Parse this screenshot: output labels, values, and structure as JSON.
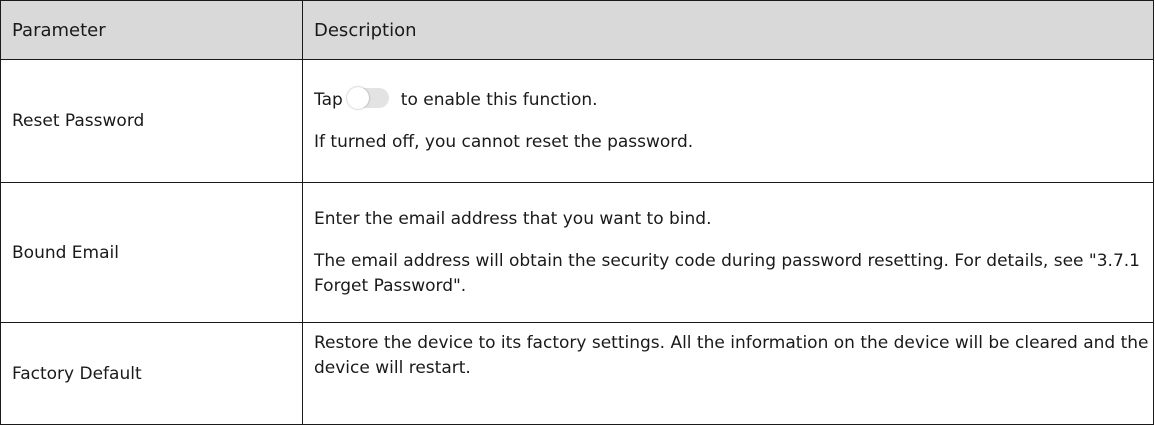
{
  "table": {
    "headers": {
      "parameter": "Parameter",
      "description": "Description"
    },
    "rows": [
      {
        "parameter": "Reset Password",
        "description": {
          "before_toggle": "Tap",
          "after_toggle": "to enable this function.",
          "line2": "If turned off, you cannot reset the password."
        },
        "toggle_state": "off"
      },
      {
        "parameter": "Bound Email",
        "description": {
          "line1": "Enter the email address that you want to bind.",
          "line2": "The email address will obtain the security code during password resetting. For details, see \"3.7.1 Forget Password\"."
        }
      },
      {
        "parameter": "Factory Default",
        "description": {
          "line1": "Restore the device to its factory settings. All the information on the device will be cleared and the device will restart."
        }
      }
    ]
  },
  "colors": {
    "header_background": "#d9d9d9",
    "border": "#1a1a1a",
    "toggle_off": "#e3e3e3"
  }
}
